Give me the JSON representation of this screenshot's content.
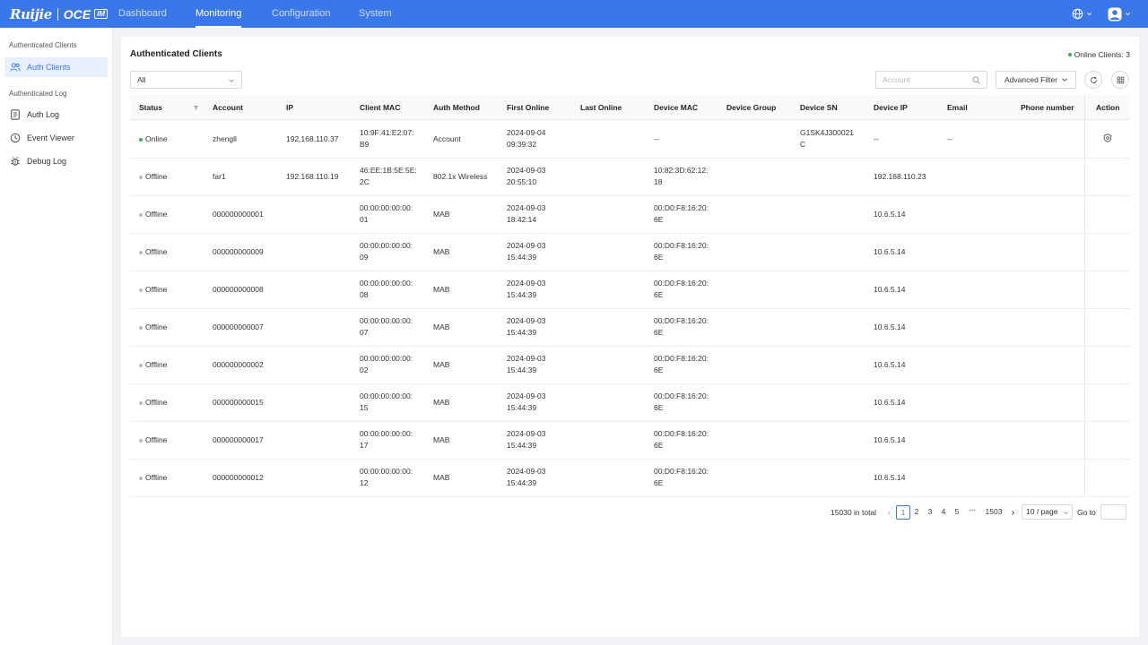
{
  "header": {
    "logo_brand": "Ruijie",
    "logo_product": "OCE",
    "logo_badge": "IM",
    "nav": [
      "Dashboard",
      "Monitoring",
      "Configuration",
      "System"
    ],
    "active_nav": "Monitoring",
    "accent_color": "#3a77e9",
    "icons": [
      "globe-icon",
      "user-avatar-icon"
    ]
  },
  "sidebar": {
    "groups": [
      {
        "label": "Authenticated Clients",
        "items": [
          {
            "label": "Auth Clients",
            "icon": "users-icon",
            "active": true
          }
        ]
      },
      {
        "label": "Authenticated Log",
        "items": [
          {
            "label": "Auth Log",
            "icon": "document-icon"
          },
          {
            "label": "Event Viewer",
            "icon": "clock-icon"
          },
          {
            "label": "Debug Log",
            "icon": "bug-icon"
          }
        ]
      }
    ]
  },
  "main": {
    "title": "Authenticated Clients",
    "online_clients": "Online Clients: 3",
    "filter_value": "All",
    "search_placeholder": "Account",
    "advanced_filter": "Advanced Filter",
    "columns": [
      "Status",
      "Account",
      "IP",
      "Client MAC",
      "Auth Method",
      "First Online",
      "Last Online",
      "Device MAC",
      "Device Group",
      "Device SN",
      "Device IP",
      "Email",
      "Phone number",
      "Action"
    ],
    "rows": [
      {
        "status": "Online",
        "account": "zhengll",
        "ip": "192.168.110.37",
        "client_mac": [
          "10:9F:41:E2:07:",
          "B9"
        ],
        "auth_method": "Account",
        "first_online": [
          "2024-09-04",
          "09:39:32"
        ],
        "last_online": "",
        "device_mac": [
          "--"
        ],
        "device_group": "",
        "device_sn": [
          "G1SK4J300021",
          "C"
        ],
        "device_ip": "--",
        "email": "--",
        "phone": "",
        "action": true
      },
      {
        "status": "Offline",
        "account": "far1",
        "ip": "192.168.110.19",
        "client_mac": [
          "46:EE:1B:5E:5E:",
          "2C"
        ],
        "auth_method": "802.1x Wireless",
        "first_online": [
          "2024-09-03",
          "20:55:10"
        ],
        "last_online": "",
        "device_mac": [
          "10:82:3D:62:12:",
          "18"
        ],
        "device_group": "",
        "device_sn": [],
        "device_ip": "192.168.110.23",
        "email": "",
        "phone": "",
        "action": false
      },
      {
        "status": "Offline",
        "account": "000000000001",
        "ip": "",
        "client_mac": [
          "00:00:00:00:00:",
          "01"
        ],
        "auth_method": "MAB",
        "first_online": [
          "2024-09-03",
          "18:42:14"
        ],
        "last_online": "",
        "device_mac": [
          "00:D0:F8:16:20:",
          "6E"
        ],
        "device_group": "",
        "device_sn": [],
        "device_ip": "10.6.5.14",
        "email": "",
        "phone": "",
        "action": false
      },
      {
        "status": "Offline",
        "account": "000000000009",
        "ip": "",
        "client_mac": [
          "00:00:00:00:00:",
          "09"
        ],
        "auth_method": "MAB",
        "first_online": [
          "2024-09-03",
          "15:44:39"
        ],
        "last_online": "",
        "device_mac": [
          "00:D0:F8:16:20:",
          "6E"
        ],
        "device_group": "",
        "device_sn": [],
        "device_ip": "10.6.5.14",
        "email": "",
        "phone": "",
        "action": false
      },
      {
        "status": "Offline",
        "account": "000000000008",
        "ip": "",
        "client_mac": [
          "00:00:00:00:00:",
          "08"
        ],
        "auth_method": "MAB",
        "first_online": [
          "2024-09-03",
          "15:44:39"
        ],
        "last_online": "",
        "device_mac": [
          "00:D0:F8:16:20:",
          "6E"
        ],
        "device_group": "",
        "device_sn": [],
        "device_ip": "10.6.5.14",
        "email": "",
        "phone": "",
        "action": false
      },
      {
        "status": "Offline",
        "account": "000000000007",
        "ip": "",
        "client_mac": [
          "00:00:00:00:00:",
          "07"
        ],
        "auth_method": "MAB",
        "first_online": [
          "2024-09-03",
          "15:44:39"
        ],
        "last_online": "",
        "device_mac": [
          "00:D0:F8:16:20:",
          "6E"
        ],
        "device_group": "",
        "device_sn": [],
        "device_ip": "10.6.5.14",
        "email": "",
        "phone": "",
        "action": false
      },
      {
        "status": "Offline",
        "account": "000000000002",
        "ip": "",
        "client_mac": [
          "00:00:00:00:00:",
          "02"
        ],
        "auth_method": "MAB",
        "first_online": [
          "2024-09-03",
          "15:44:39"
        ],
        "last_online": "",
        "device_mac": [
          "00:D0:F8:16:20:",
          "6E"
        ],
        "device_group": "",
        "device_sn": [],
        "device_ip": "10.6.5.14",
        "email": "",
        "phone": "",
        "action": false
      },
      {
        "status": "Offline",
        "account": "000000000015",
        "ip": "",
        "client_mac": [
          "00:00:00:00:00:",
          "15"
        ],
        "auth_method": "MAB",
        "first_online": [
          "2024-09-03",
          "15:44:39"
        ],
        "last_online": "",
        "device_mac": [
          "00:D0:F8:16:20:",
          "6E"
        ],
        "device_group": "",
        "device_sn": [],
        "device_ip": "10.6.5.14",
        "email": "",
        "phone": "",
        "action": false
      },
      {
        "status": "Offline",
        "account": "000000000017",
        "ip": "",
        "client_mac": [
          "00:00:00:00:00:",
          "17"
        ],
        "auth_method": "MAB",
        "first_online": [
          "2024-09-03",
          "15:44:39"
        ],
        "last_online": "",
        "device_mac": [
          "00:D0:F8:16:20:",
          "6E"
        ],
        "device_group": "",
        "device_sn": [],
        "device_ip": "10.6.5.14",
        "email": "",
        "phone": "",
        "action": false
      },
      {
        "status": "Offline",
        "account": "000000000012",
        "ip": "",
        "client_mac": [
          "00:00:00:00:00:",
          "12"
        ],
        "auth_method": "MAB",
        "first_online": [
          "2024-09-03",
          "15:44:39"
        ],
        "last_online": "",
        "device_mac": [
          "00:D0:F8:16:20:",
          "6E"
        ],
        "device_group": "",
        "device_sn": [],
        "device_ip": "10.6.5.14",
        "email": "",
        "phone": "",
        "action": false
      }
    ],
    "status_colors": {
      "Online": "#38b24a",
      "Offline": "#bbbbbb"
    }
  },
  "pagination": {
    "total": "15030 in total",
    "pages": [
      "1",
      "2",
      "3",
      "4",
      "5"
    ],
    "ellipsis": "•••",
    "last_page": "1503",
    "current": "1",
    "page_size": "10 / page",
    "goto_label": "Go to",
    "goto_value": ""
  }
}
